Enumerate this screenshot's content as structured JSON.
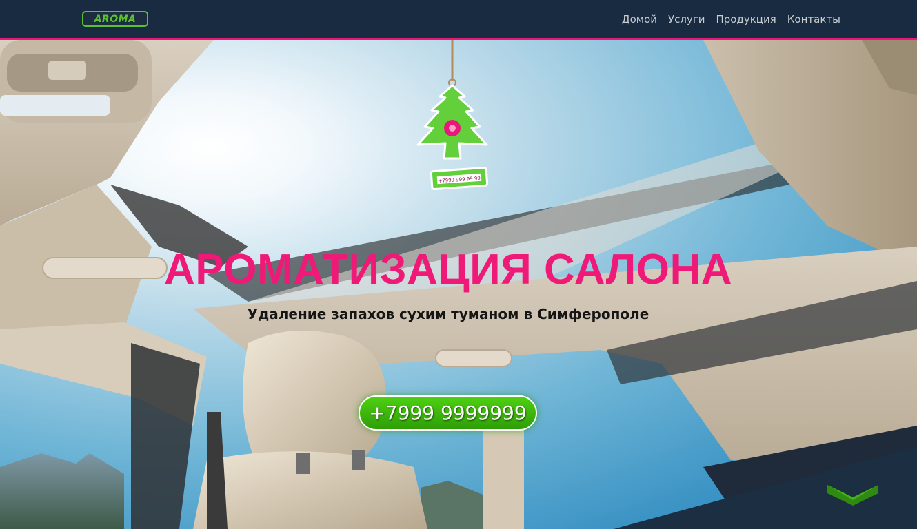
{
  "navbar": {
    "logo_text": "AROMA",
    "links": [
      "Домой",
      "Услуги",
      "Продукция",
      "Контакты"
    ]
  },
  "hero": {
    "title": "АРОМАТИЗАЦИЯ САЛОНА",
    "subtitle": "Удаление запахов сухим туманом в Симферополе",
    "phone_button": "+7999 9999999",
    "freshener_phone": "+7999 999 99 99"
  },
  "colors": {
    "navbar_bg": "#192b40",
    "accent_pink": "#ef1a78",
    "button_green": "#3bb80c",
    "logo_green": "#5cc12e"
  },
  "icons": [
    "flower-icon",
    "chevron-down-icon"
  ]
}
